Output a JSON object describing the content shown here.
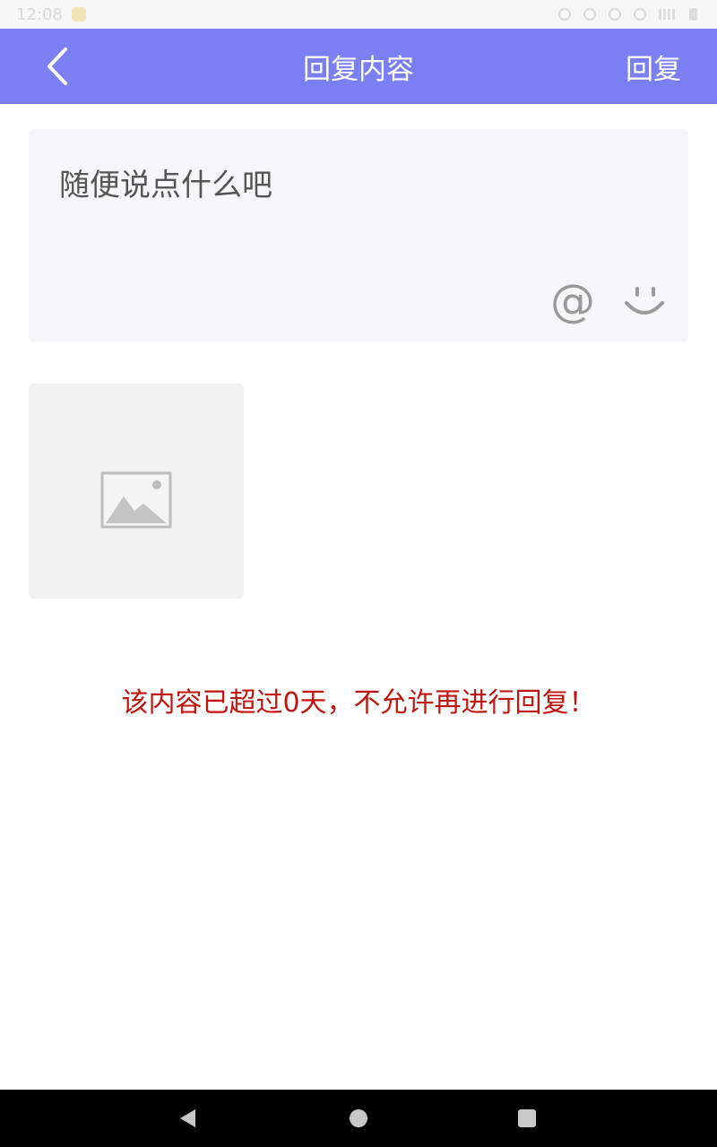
{
  "status_bar": {
    "time": "12:08",
    "icons": [
      "notification-icon",
      "alarm-icon",
      "sync-icon",
      "circle-icon",
      "wifi-icon",
      "signal-icon",
      "battery-icon"
    ]
  },
  "nav": {
    "title": "回复内容",
    "reply_label": "回复",
    "accent_color": "#7b7ff2"
  },
  "composer": {
    "placeholder": "随便说点什么吧",
    "at_symbol": "@"
  },
  "warning": {
    "text": "该内容已超过0天，不允许再进行回复！",
    "color": "#c0150e"
  },
  "system_nav": {
    "buttons": [
      "back-icon",
      "home-icon",
      "recents-icon"
    ]
  }
}
